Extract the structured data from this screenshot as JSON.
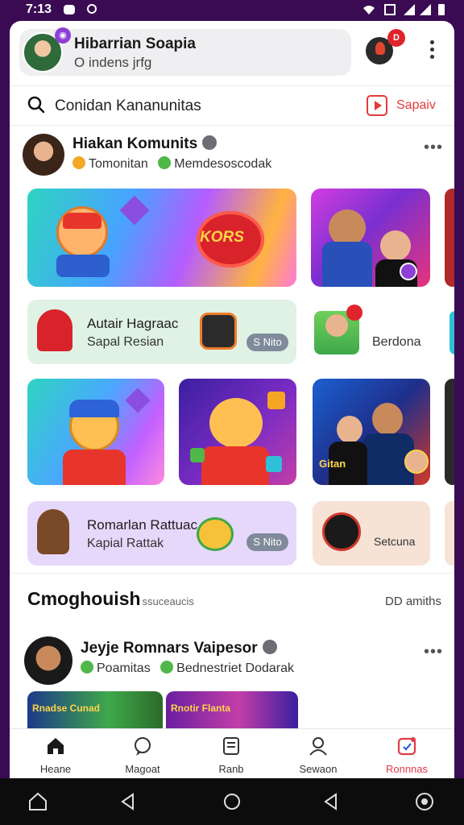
{
  "status_bar": {
    "time": "7:13"
  },
  "header": {
    "profile_name": "Hibarrian Soapia",
    "profile_sub": "O indens jrfg",
    "notification_badge": "D"
  },
  "search": {
    "text": "Conidan Kananunitas",
    "share_label": "Sapaiv"
  },
  "post1": {
    "title": "Hiakan Komunits",
    "sub_a": "Tomonitan",
    "sub_b": "Memdesoscodak",
    "hero_text": "KORS",
    "card_title": "Autair Hagraac",
    "card_sub": "Sapal Resian",
    "card_chip": "S Nito",
    "side_label": "Berdona",
    "tile_caption": "Gitan",
    "card2_title": "Romarlan Rattuac",
    "card2_sub": "Kapial Rattak",
    "card2_chip": "S Nito",
    "side2_label": "Setcuna"
  },
  "section": {
    "title": "Cmoghouish",
    "subtitle": "ssuceaucis",
    "link": "DD amiths"
  },
  "post2": {
    "title": "Jeyje Romnars Vaipesor",
    "sub_a": "Poamitas",
    "sub_b": "Bednestriet Dodarak",
    "thumb1_text": "Rnadse Cunad",
    "thumb2_text": "Rnotir Flanta"
  },
  "bottom_nav": [
    {
      "label": "Heane",
      "icon": "home-icon"
    },
    {
      "label": "Magoat",
      "icon": "chat-icon"
    },
    {
      "label": "Ranb",
      "icon": "document-icon"
    },
    {
      "label": "Sewaon",
      "icon": "person-icon"
    },
    {
      "label": "Ronnnas",
      "icon": "calendar-icon"
    }
  ],
  "colors": {
    "accent": "#e03b4b",
    "status_bar": "#3a0b52"
  }
}
